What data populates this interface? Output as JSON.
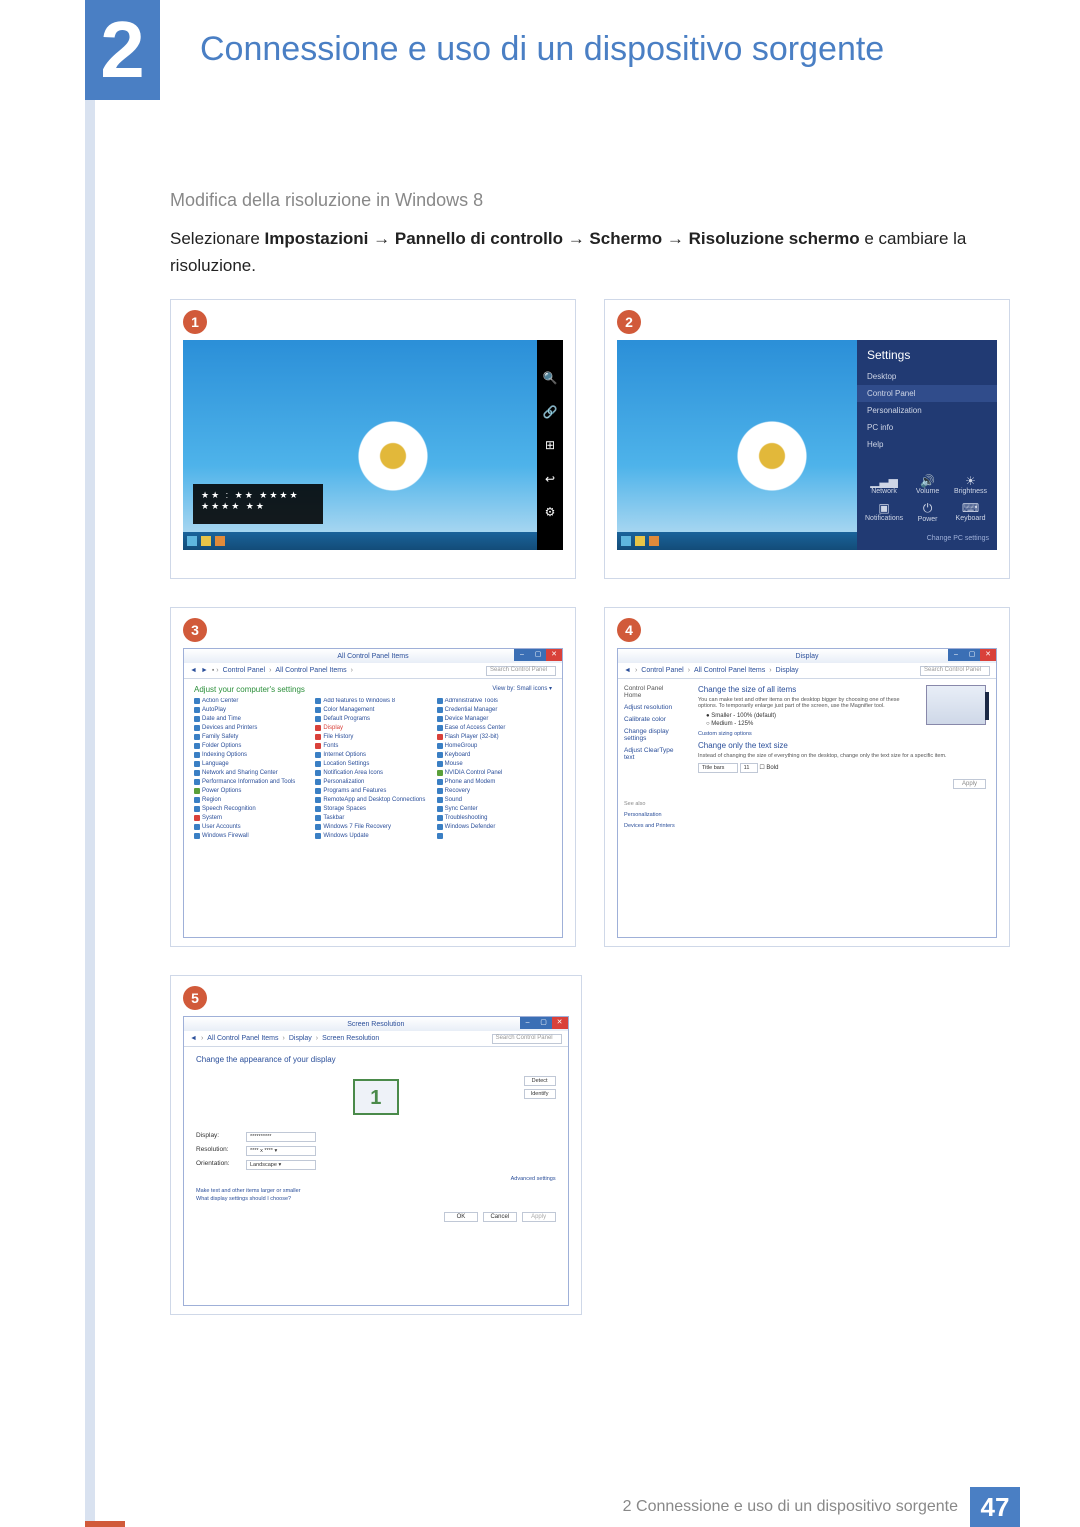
{
  "chapter": {
    "num": "2",
    "title": "Connessione e uso di un dispositivo sorgente"
  },
  "section": {
    "heading": "Modifica della risoluzione in Windows 8",
    "lead": "Selezionare ",
    "path": "Impostazioni → Pannello di controllo → Schermo → Risoluzione schermo",
    "tail": " e cambiare la risoluzione."
  },
  "steps": {
    "s1": {
      "num": "1",
      "charms": [
        "🔍",
        "🔗",
        "⊞",
        "↩",
        "⚙"
      ],
      "time_overlay": "★★ : ★★    ★★★★\n                ★★★★  ★★"
    },
    "s2": {
      "num": "2",
      "settings_title": "Settings",
      "items": [
        "Desktop",
        "Control Panel",
        "Personalization",
        "PC info",
        "Help"
      ],
      "icons": [
        {
          "glyph": "▁▃▅",
          "label": "Network"
        },
        {
          "glyph": "🔊",
          "label": "Volume"
        },
        {
          "glyph": "☀",
          "label": "Brightness"
        },
        {
          "glyph": "▣",
          "label": "Notifications"
        },
        {
          "glyph": "⏻",
          "label": "Power"
        },
        {
          "glyph": "⌨",
          "label": "Keyboard"
        }
      ],
      "link": "Change PC settings"
    },
    "s3": {
      "num": "3",
      "title": "All Control Panel Items",
      "breadcrumb": [
        "Control Panel",
        "All Control Panel Items"
      ],
      "search": "Search Control Panel",
      "head": "Adjust your computer's settings",
      "view": "View by:   Small icons ▾",
      "items": [
        "Action Center",
        "Add features to Windows 8",
        "Administrative Tools",
        "AutoPlay",
        "Color Management",
        "Credential Manager",
        "Date and Time",
        "Default Programs",
        "Device Manager",
        "Devices and Printers",
        "Display",
        "Ease of Access Center",
        "Family Safety",
        "File History",
        "Flash Player (32-bit)",
        "Folder Options",
        "Fonts",
        "HomeGroup",
        "Indexing Options",
        "Internet Options",
        "Keyboard",
        "Language",
        "Location Settings",
        "Mouse",
        "Network and Sharing Center",
        "Notification Area Icons",
        "NVIDIA Control Panel",
        "Performance Information and Tools",
        "Personalization",
        "Phone and Modem",
        "Power Options",
        "Programs and Features",
        "Recovery",
        "Region",
        "RemoteApp and Desktop Connections",
        "Sound",
        "Speech Recognition",
        "Storage Spaces",
        "Sync Center",
        "System",
        "Taskbar",
        "Troubleshooting",
        "User Accounts",
        "Windows 7 File Recovery",
        "Windows Defender",
        "Windows Firewall",
        "Windows Update",
        ""
      ],
      "colors": [
        "#3a7fc4",
        "#3a7fc4",
        "#3a7fc4",
        "#3a7fc4",
        "#3a7fc4",
        "#3a7fc4",
        "#3a7fc4",
        "#3a7fc4",
        "#3a7fc4",
        "#3a7fc4",
        "#d9413a",
        "#3a7fc4",
        "#3a7fc4",
        "#d9413a",
        "#d9413a",
        "#3a7fc4",
        "#d9413a",
        "#3a7fc4",
        "#3a7fc4",
        "#3a7fc4",
        "#3a7fc4",
        "#3a7fc4",
        "#3a7fc4",
        "#3a7fc4",
        "#3a7fc4",
        "#3a7fc4",
        "#5aa03a",
        "#3a7fc4",
        "#3a7fc4",
        "#3a7fc4",
        "#5aa03a",
        "#3a7fc4",
        "#3a7fc4",
        "#3a7fc4",
        "#3a7fc4",
        "#3a7fc4",
        "#3a7fc4",
        "#3a7fc4",
        "#3a7fc4",
        "#d9413a",
        "#3a7fc4",
        "#3a7fc4",
        "#3a7fc4",
        "#3a7fc4",
        "#3a7fc4",
        "#3a7fc4",
        "#3a7fc4",
        "#3a7fc4"
      ]
    },
    "s4": {
      "num": "4",
      "title": "Display",
      "breadcrumb": [
        "Control Panel",
        "All Control Panel Items",
        "Display"
      ],
      "search": "Search Control Panel",
      "side_head": "Control Panel Home",
      "side": [
        "Adjust resolution",
        "Calibrate color",
        "Change display settings",
        "Adjust ClearType text"
      ],
      "h1": "Change the size of all items",
      "p1": "You can make text and other items on the desktop bigger by choosing one of these options. To temporarily enlarge just part of the screen, use the Magnifier tool.",
      "opts": [
        "● Smaller - 100% (default)",
        "○ Medium - 125%"
      ],
      "link1": "Custom sizing options",
      "h2": "Change only the text size",
      "p2": "Instead of changing the size of everything on the desktop, change only the text size for a specific item.",
      "row_label": "Title bars",
      "row_size": "11",
      "row_bold": "Bold",
      "apply": "Apply",
      "also_head": "See also",
      "also": [
        "Personalization",
        "Devices and Printers"
      ]
    },
    "s5": {
      "num": "5",
      "title": "Screen Resolution",
      "breadcrumb": [
        "All Control Panel Items",
        "Display",
        "Screen Resolution"
      ],
      "search": "Search Control Panel",
      "h": "Change the appearance of your display",
      "mon": "1",
      "btns": [
        "Detect",
        "Identify"
      ],
      "rows": [
        {
          "label": "Display:",
          "value": "**********"
        },
        {
          "label": "Resolution:",
          "value": "**** x **** ▾"
        },
        {
          "label": "Orientation:",
          "value": "Landscape ▾"
        }
      ],
      "adv": "Advanced settings",
      "links": [
        "Make text and other items larger or smaller",
        "What display settings should I choose?"
      ],
      "dlg": [
        "OK",
        "Cancel",
        "Apply"
      ]
    }
  },
  "footer": {
    "text": "2 Connessione e uso di un dispositivo sorgente",
    "page": "47"
  }
}
